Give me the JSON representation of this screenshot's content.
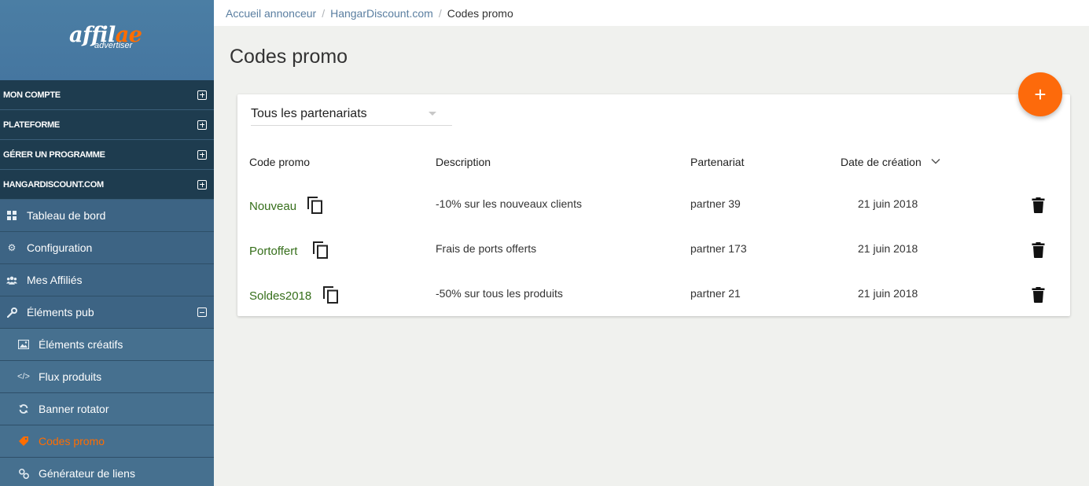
{
  "brand": {
    "logo_main": "affil",
    "logo_accent": "ae",
    "logo_sub": "advertiser"
  },
  "sidebar": {
    "sections": [
      {
        "label": "MON COMPTE"
      },
      {
        "label": "PLATEFORME"
      },
      {
        "label": "GÉRER UN PROGRAMME"
      },
      {
        "label": "HANGARDISCOUNT.COM"
      }
    ],
    "items": [
      {
        "label": "Tableau de bord",
        "icon": "dashboard-icon"
      },
      {
        "label": "Configuration",
        "icon": "gear-icon"
      },
      {
        "label": "Mes Affiliés",
        "icon": "users-icon"
      },
      {
        "label": "Éléments pub",
        "icon": "wrench-icon"
      },
      {
        "label": "Éléments créatifs",
        "icon": "image-icon"
      },
      {
        "label": "Flux produits",
        "icon": "code-icon"
      },
      {
        "label": "Banner rotator",
        "icon": "refresh-icon"
      },
      {
        "label": "Codes promo",
        "icon": "tag-icon"
      },
      {
        "label": "Générateur de liens",
        "icon": "link-icon"
      }
    ]
  },
  "breadcrumb": {
    "items": [
      "Accueil annonceur",
      "HangarDiscount.com"
    ],
    "current": "Codes promo",
    "separator": "/"
  },
  "page": {
    "title": "Codes promo"
  },
  "filter": {
    "selected": "Tous les partenariats"
  },
  "table": {
    "headers": [
      "Code promo",
      "Description",
      "Partenariat",
      "Date de création"
    ],
    "rows": [
      {
        "code": "Nouveau",
        "description": "-10% sur les nouveaux clients",
        "partner": "partner 39",
        "date": "21 juin 2018"
      },
      {
        "code": "Portoffert",
        "description": "Frais de ports offerts",
        "partner": "partner 173",
        "date": "21 juin 2018"
      },
      {
        "code": "Soldes2018",
        "description": "-50% sur tous les produits",
        "partner": "partner 21",
        "date": "21 juin 2018"
      }
    ]
  },
  "fab": {
    "label": "+"
  },
  "colors": {
    "accent": "#fd6a0b",
    "sidebar": "#3d6484",
    "sidebar_section": "#1e3c4f",
    "code_text": "#356e1a"
  }
}
